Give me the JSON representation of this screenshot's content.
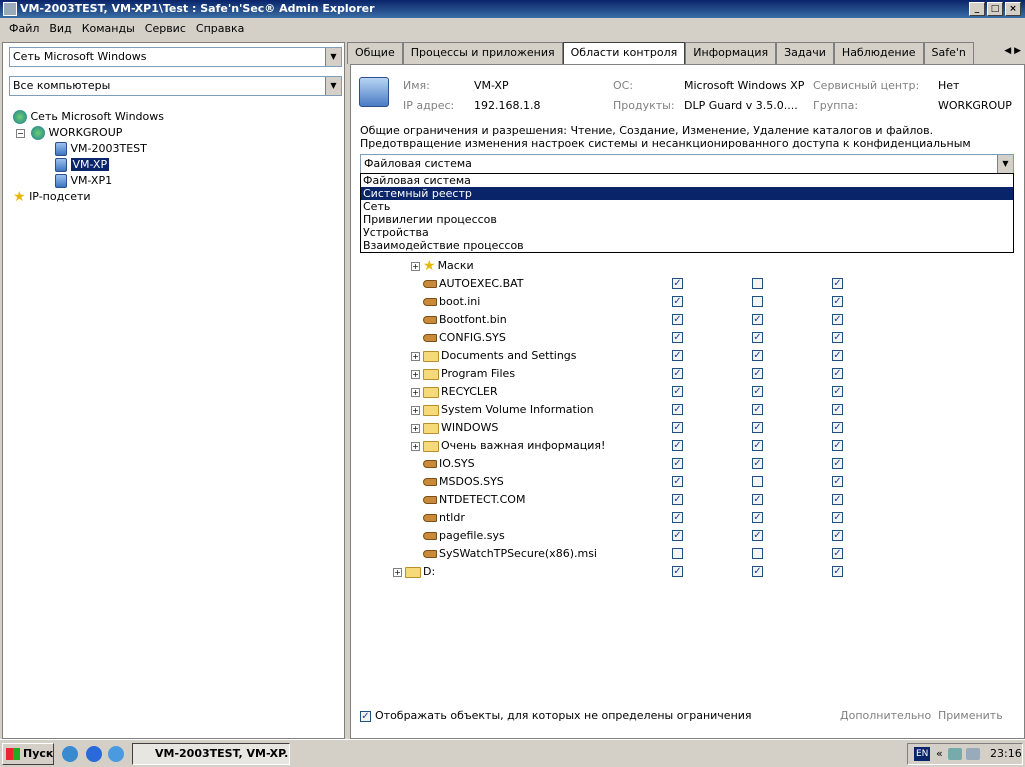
{
  "window": {
    "title": "VM-2003TEST, VM-XP1\\Test : Safe'n'Sec® Admin Explorer"
  },
  "menu": [
    "Файл",
    "Вид",
    "Команды",
    "Сервис",
    "Справка"
  ],
  "left": {
    "network_combo": "Сеть Microsoft Windows",
    "filter_combo": "Все компьютеры",
    "tree": {
      "root": "Сеть Microsoft Windows",
      "group": "WORKGROUP",
      "computers": [
        "VM-2003TEST",
        "VM-XP",
        "VM-XP1"
      ],
      "ip": "IP-подсети"
    }
  },
  "tabs": [
    "Общие",
    "Процессы и приложения",
    "Области контроля",
    "Информация",
    "Задачи",
    "Наблюдение",
    "Safe'n"
  ],
  "info": {
    "name_label": "Имя:",
    "name": "VM-XP",
    "os_label": "ОС:",
    "os": "Microsoft Windows XP",
    "sc_label": "Сервисный центр:",
    "sc": "Нет",
    "ip_label": "IP адрес:",
    "ip": "192.168.1.8",
    "products_label": "Продукты:",
    "products": "DLP Guard v 3.5.0....",
    "group_label": "Группа:",
    "group": "WORKGROUP"
  },
  "desc": {
    "line1": "Общие ограничения и разрешения: Чтение, Создание, Изменение, Удаление каталогов и файлов.",
    "line2": "Предотвращение изменения настроек системы и несанкционированного доступа к конфиденциальным"
  },
  "dropdown": {
    "selected": "Файловая система",
    "options": [
      "Файловая система",
      "Системный реестр",
      "Сеть",
      "Привилегии процессов",
      "Устройства",
      "Взаимодействие процессов"
    ],
    "highlighted_index": 1
  },
  "files": [
    {
      "name": "Маски",
      "type": "star",
      "c": [
        false,
        false,
        false
      ]
    },
    {
      "name": "AUTOEXEC.BAT",
      "type": "file",
      "c": [
        true,
        false,
        true
      ]
    },
    {
      "name": "boot.ini",
      "type": "file",
      "c": [
        true,
        false,
        true
      ]
    },
    {
      "name": "Bootfont.bin",
      "type": "file",
      "c": [
        true,
        true,
        true
      ]
    },
    {
      "name": "CONFIG.SYS",
      "type": "file",
      "c": [
        true,
        true,
        true
      ]
    },
    {
      "name": "Documents and Settings",
      "type": "folder",
      "c": [
        true,
        true,
        true
      ]
    },
    {
      "name": "Program Files",
      "type": "folder",
      "c": [
        true,
        true,
        true
      ]
    },
    {
      "name": "RECYCLER",
      "type": "folder",
      "c": [
        true,
        true,
        true
      ]
    },
    {
      "name": "System Volume Information",
      "type": "folder",
      "c": [
        true,
        true,
        true
      ]
    },
    {
      "name": "WINDOWS",
      "type": "folder",
      "c": [
        true,
        true,
        true
      ]
    },
    {
      "name": "Очень важная информация!",
      "type": "folder",
      "c": [
        true,
        true,
        true
      ]
    },
    {
      "name": "IO.SYS",
      "type": "file",
      "c": [
        true,
        true,
        true
      ]
    },
    {
      "name": "MSDOS.SYS",
      "type": "file",
      "c": [
        true,
        false,
        true
      ]
    },
    {
      "name": "NTDETECT.COM",
      "type": "file",
      "c": [
        true,
        true,
        true
      ]
    },
    {
      "name": "ntldr",
      "type": "file",
      "c": [
        true,
        true,
        true
      ]
    },
    {
      "name": "pagefile.sys",
      "type": "file",
      "c": [
        true,
        true,
        true
      ]
    },
    {
      "name": "SySWatchTPSecure(x86).msi",
      "type": "file",
      "c": [
        false,
        false,
        true
      ]
    },
    {
      "name": "D:",
      "type": "folder",
      "c": [
        true,
        true,
        true
      ]
    }
  ],
  "bottom": {
    "show_label": "Отображать объекты, для которых не определены ограничения",
    "more": "Дополнительно",
    "apply": "Применить"
  },
  "taskbar": {
    "start": "Пуск",
    "task": "VM-2003TEST, VM-XP...",
    "lang": "EN",
    "time": "23:16"
  }
}
